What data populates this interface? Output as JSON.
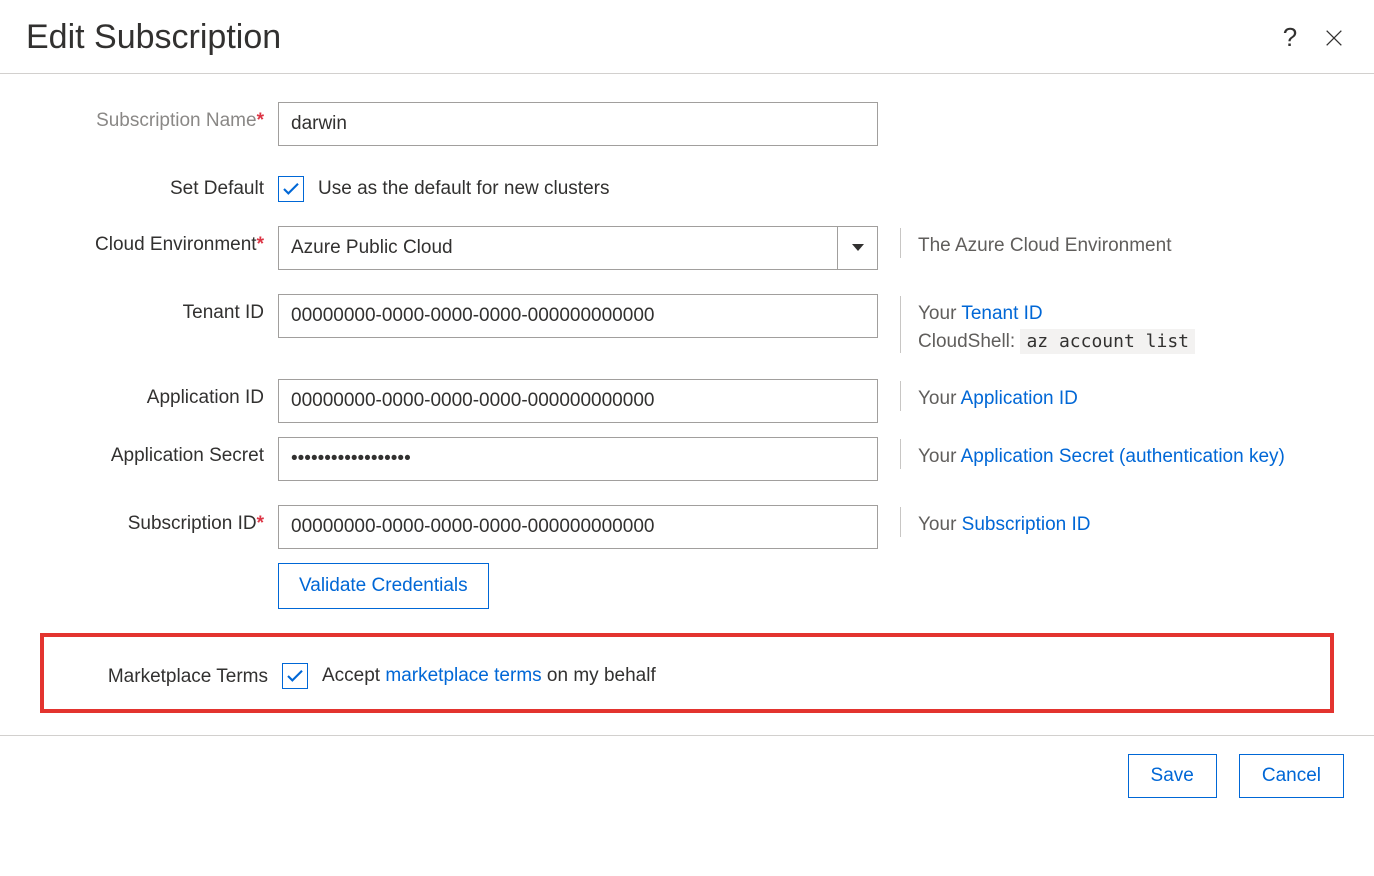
{
  "header": {
    "title": "Edit Subscription"
  },
  "fields": {
    "subscription_name": {
      "label": "Subscription Name",
      "value": "darwin"
    },
    "set_default": {
      "label": "Set Default",
      "checked": true,
      "text": "Use as the default for new clusters"
    },
    "cloud_env": {
      "label": "Cloud Environment",
      "value": "Azure Public Cloud",
      "help": "The Azure Cloud Environment"
    },
    "tenant_id": {
      "label": "Tenant ID",
      "value": "00000000-0000-0000-0000-000000000000",
      "help_pre": "Your ",
      "help_link": "Tenant ID",
      "help_line2_pre": "CloudShell: ",
      "help_line2_code": "az account list"
    },
    "app_id": {
      "label": "Application ID",
      "value": "00000000-0000-0000-0000-000000000000",
      "help_pre": "Your ",
      "help_link": "Application ID"
    },
    "app_secret": {
      "label": "Application Secret",
      "value": "••••••••••••••••••",
      "help_pre": "Your ",
      "help_link": "Application Secret (authentication key)"
    },
    "subscription_id": {
      "label": "Subscription ID",
      "value": "00000000-0000-0000-0000-000000000000",
      "help_pre": "Your ",
      "help_link": "Subscription ID"
    },
    "validate_label": "Validate Credentials",
    "marketplace": {
      "label": "Marketplace Terms",
      "checked": true,
      "text_pre": "Accept ",
      "text_link": "marketplace terms",
      "text_post": " on my behalf"
    }
  },
  "footer": {
    "save": "Save",
    "cancel": "Cancel"
  }
}
